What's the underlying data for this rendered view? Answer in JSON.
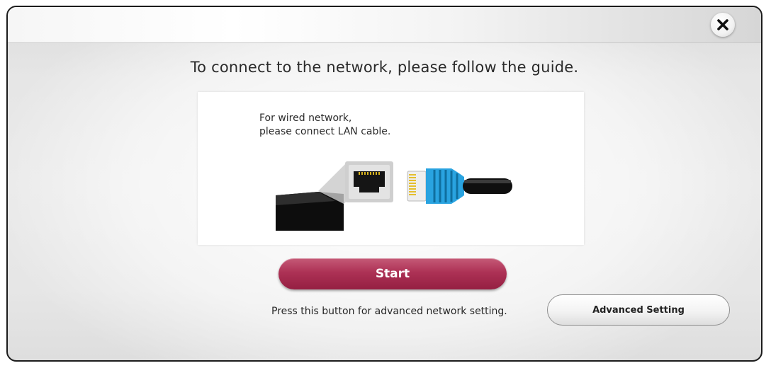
{
  "dialog": {
    "heading": "To connect to the network, please follow the guide.",
    "close_icon": "close-icon"
  },
  "guide": {
    "line1": "For wired network,",
    "line2": "please connect LAN cable.",
    "illustration": "lan-cable-illustration"
  },
  "actions": {
    "start_label": "Start",
    "advanced_hint": "Press this button for advanced network setting.",
    "advanced_label": "Advanced Setting"
  },
  "colors": {
    "start_button": "#ad3155",
    "cable_connector": "#29a3e0",
    "text": "#2a2a2a"
  }
}
